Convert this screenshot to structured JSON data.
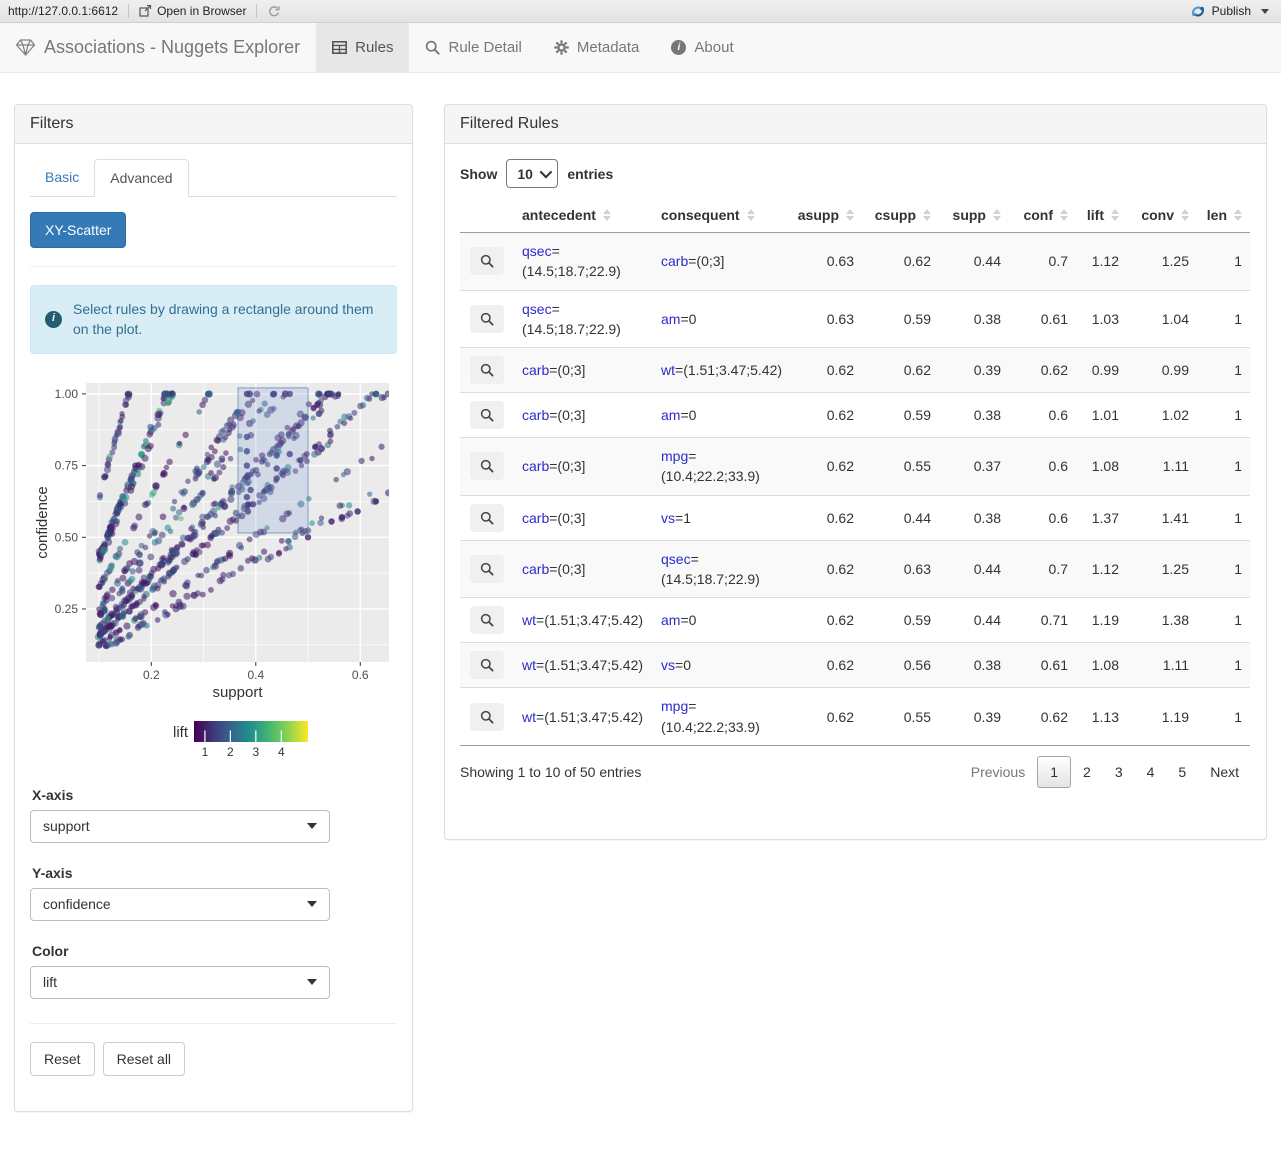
{
  "theme": {
    "accent": "#337ab7",
    "attr_color": "#2b2bcd",
    "value_color": "#1e8f1e",
    "alert_bg": "#d9edf7",
    "alert_text": "#31708f"
  },
  "viewer_bar": {
    "url": "http://127.0.0.1:6612",
    "open_in_browser": "Open in Browser",
    "publish": "Publish"
  },
  "navbar": {
    "brand": "Associations - Nuggets Explorer",
    "tabs": [
      {
        "label": "Rules"
      },
      {
        "label": "Rule Detail"
      },
      {
        "label": "Metadata"
      },
      {
        "label": "About"
      }
    ]
  },
  "filters": {
    "title": "Filters",
    "tabs": [
      {
        "label": "Basic"
      },
      {
        "label": "Advanced"
      }
    ],
    "scatter_button": "XY-Scatter",
    "info_text": "Select rules by drawing a rectangle around them on the plot.",
    "controls": [
      {
        "label": "X-axis",
        "value": "support"
      },
      {
        "label": "Y-axis",
        "value": "confidence"
      },
      {
        "label": "Color",
        "value": "lift"
      }
    ],
    "reset": "Reset",
    "reset_all": "Reset all"
  },
  "chart_data": {
    "type": "scatter",
    "xlabel": "support",
    "ylabel": "confidence",
    "x_ticks": [
      0.2,
      0.4,
      0.6
    ],
    "y_ticks": [
      0.25,
      0.5,
      0.75,
      1
    ],
    "x_range": [
      0.075,
      0.655
    ],
    "y_range": [
      0.065,
      1.038
    ],
    "grid": true,
    "panel_color": "#EBEBEB",
    "color_legend": {
      "label": "lift",
      "scale": "viridis",
      "ticks": [
        1,
        2,
        3,
        4
      ],
      "range": [
        0.57,
        5.05
      ]
    },
    "selection_rect": {
      "x": [
        0.366,
        0.5
      ],
      "y": [
        0.515,
        1.021
      ]
    },
    "generator": {
      "seed": 1337,
      "n": 950,
      "palette_size": 24,
      "support_min": 0.1,
      "top_line_fraction": 0.08
    },
    "selection_points": [
      [
        0.383,
        1.0
      ],
      [
        0.435,
        1.0
      ],
      [
        0.465,
        1.0
      ],
      [
        0.383,
        0.85
      ],
      [
        0.383,
        0.8
      ],
      [
        0.44,
        0.785
      ],
      [
        0.465,
        0.79
      ],
      [
        0.383,
        0.75
      ],
      [
        0.44,
        0.74
      ],
      [
        0.383,
        0.71
      ],
      [
        0.44,
        0.705
      ],
      [
        0.39,
        0.665
      ],
      [
        0.383,
        0.64
      ],
      [
        0.395,
        0.615
      ],
      [
        0.385,
        0.59
      ],
      [
        0.5,
        0.5
      ]
    ],
    "outlier_points": [
      [
        0.545,
        0.555
      ],
      [
        0.565,
        0.57
      ],
      [
        0.595,
        0.59
      ],
      [
        0.63,
        0.625
      ]
    ]
  },
  "table_panel": {
    "title": "Filtered Rules",
    "show_label": "Show",
    "page_size": "10",
    "entries_label": "entries",
    "columns": [
      "antecedent",
      "consequent",
      "asupp",
      "csupp",
      "supp",
      "conf",
      "lift",
      "conv",
      "len"
    ],
    "rows": [
      {
        "antecedent": {
          "attr": "qsec",
          "value": "(14.5;18.7;22.9)"
        },
        "consequent": {
          "attr": "carb",
          "value": "(0;3]"
        },
        "asupp": "0.63",
        "csupp": "0.62",
        "supp": "0.44",
        "conf": "0.7",
        "lift": "1.12",
        "conv": "1.25",
        "len": "1"
      },
      {
        "antecedent": {
          "attr": "qsec",
          "value": "(14.5;18.7;22.9)"
        },
        "consequent": {
          "attr": "am",
          "value": "0"
        },
        "asupp": "0.63",
        "csupp": "0.59",
        "supp": "0.38",
        "conf": "0.61",
        "lift": "1.03",
        "conv": "1.04",
        "len": "1"
      },
      {
        "antecedent": {
          "attr": "carb",
          "value": "(0;3]"
        },
        "consequent": {
          "attr": "wt",
          "value": "(1.51;3.47;5.42)"
        },
        "asupp": "0.62",
        "csupp": "0.62",
        "supp": "0.39",
        "conf": "0.62",
        "lift": "0.99",
        "conv": "0.99",
        "len": "1"
      },
      {
        "antecedent": {
          "attr": "carb",
          "value": "(0;3]"
        },
        "consequent": {
          "attr": "am",
          "value": "0"
        },
        "asupp": "0.62",
        "csupp": "0.59",
        "supp": "0.38",
        "conf": "0.6",
        "lift": "1.01",
        "conv": "1.02",
        "len": "1"
      },
      {
        "antecedent": {
          "attr": "carb",
          "value": "(0;3]"
        },
        "consequent": {
          "attr": "mpg",
          "value": "(10.4;22.2;33.9)"
        },
        "asupp": "0.62",
        "csupp": "0.55",
        "supp": "0.37",
        "conf": "0.6",
        "lift": "1.08",
        "conv": "1.11",
        "len": "1"
      },
      {
        "antecedent": {
          "attr": "carb",
          "value": "(0;3]"
        },
        "consequent": {
          "attr": "vs",
          "value": "1"
        },
        "asupp": "0.62",
        "csupp": "0.44",
        "supp": "0.38",
        "conf": "0.6",
        "lift": "1.37",
        "conv": "1.41",
        "len": "1"
      },
      {
        "antecedent": {
          "attr": "carb",
          "value": "(0;3]"
        },
        "consequent": {
          "attr": "qsec",
          "value": "(14.5;18.7;22.9)"
        },
        "asupp": "0.62",
        "csupp": "0.63",
        "supp": "0.44",
        "conf": "0.7",
        "lift": "1.12",
        "conv": "1.25",
        "len": "1"
      },
      {
        "antecedent": {
          "attr": "wt",
          "value": "(1.51;3.47;5.42)"
        },
        "consequent": {
          "attr": "am",
          "value": "0"
        },
        "asupp": "0.62",
        "csupp": "0.59",
        "supp": "0.44",
        "conf": "0.71",
        "lift": "1.19",
        "conv": "1.38",
        "len": "1"
      },
      {
        "antecedent": {
          "attr": "wt",
          "value": "(1.51;3.47;5.42)"
        },
        "consequent": {
          "attr": "vs",
          "value": "0"
        },
        "asupp": "0.62",
        "csupp": "0.56",
        "supp": "0.38",
        "conf": "0.61",
        "lift": "1.08",
        "conv": "1.11",
        "len": "1"
      },
      {
        "antecedent": {
          "attr": "wt",
          "value": "(1.51;3.47;5.42)"
        },
        "consequent": {
          "attr": "mpg",
          "value": "(10.4;22.2;33.9)"
        },
        "asupp": "0.62",
        "csupp": "0.55",
        "supp": "0.39",
        "conf": "0.62",
        "lift": "1.13",
        "conv": "1.19",
        "len": "1"
      }
    ],
    "info": "Showing 1 to 10 of 50 entries",
    "pagination": {
      "previous": "Previous",
      "pages": [
        "1",
        "2",
        "3",
        "4",
        "5"
      ],
      "active": "1",
      "next": "Next"
    }
  }
}
